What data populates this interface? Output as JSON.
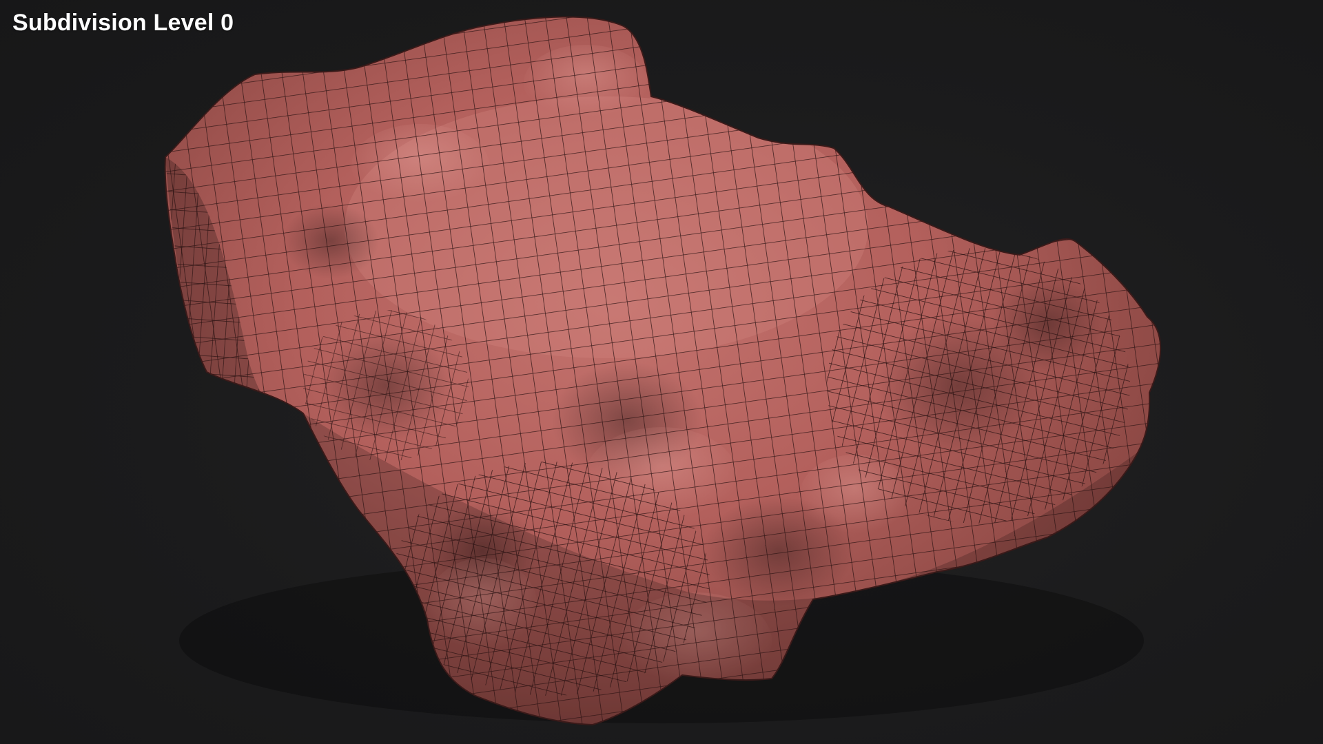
{
  "viewport": {
    "label": "Subdivision Level 0",
    "background_color": "#1b1b1c"
  },
  "model": {
    "surface_color": "#b3605c",
    "shadow_color": "#6e3533",
    "highlight_color": "#c98580",
    "wire_color": "#2a1212",
    "display": "wireframe-on-shaded"
  }
}
